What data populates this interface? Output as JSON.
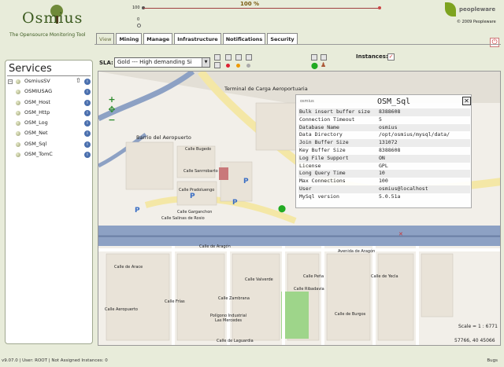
{
  "header": {
    "logo_text": "Osmius",
    "tagline": "The Opensource Monitoring Tool",
    "progress_percent_label": "100 %",
    "progress_start": "100",
    "progress_zero": "0",
    "progress_fraction": 1.0,
    "partner_logo": "peopleware",
    "copyright": "© 2009 Peopleware"
  },
  "tabs": [
    {
      "label": "View",
      "active": true
    },
    {
      "label": "Mining"
    },
    {
      "label": "Manage"
    },
    {
      "label": "Infrastructure"
    },
    {
      "label": "Notifications"
    },
    {
      "label": "Security"
    }
  ],
  "services": {
    "title": "Services",
    "items": [
      {
        "label": "OsmiusSV",
        "root": true
      },
      {
        "label": "OSMIUSAG"
      },
      {
        "label": "OSM_Host"
      },
      {
        "label": "OSM_Http"
      },
      {
        "label": "OSM_Log"
      },
      {
        "label": "OSM_Net"
      },
      {
        "label": "OSM_Sql"
      },
      {
        "label": "OSM_TomC"
      }
    ]
  },
  "toolbar": {
    "sla_label": "SLA:",
    "sla_value": "Gold --- High demanding Si",
    "instances_label": "Instances:",
    "instances_checked": true
  },
  "map": {
    "labels": [
      "Terminal de Carga Aeroportuaria",
      "Barrio del Aeropuerto",
      "Calle Bugedo",
      "Calle Sanrrobarto",
      "Calle Pradoluengo",
      "Calle Garganchon",
      "Calle Salinas de Rosio",
      "Calle de Aragón",
      "Avenida de Aragón",
      "Calle Zambrana",
      "Polígono Industrial Las Mercedes",
      "Calle de Laguardia",
      "Calle Ribadavia",
      "Calle de Arace",
      "Calle Aeropuerto",
      "Calle Frías",
      "Calle Valverde",
      "Calle Peña",
      "Calle de Yecla",
      "Calle de Burgos"
    ],
    "scale": "Scale = 1 : 6771",
    "coordinates": "57766, 40 45066"
  },
  "popup": {
    "subtitle": "osmius",
    "title": "OSM_Sql",
    "rows": [
      {
        "k": "Bulk insert buffer size",
        "v": "8388608"
      },
      {
        "k": "Connection Timeout",
        "v": "5"
      },
      {
        "k": "Database Name",
        "v": "osmius"
      },
      {
        "k": "Data Directory",
        "v": "/opt/osmius/mysql/data/"
      },
      {
        "k": "Join Buffer Size",
        "v": "131072"
      },
      {
        "k": "Key Buffer Size",
        "v": "8388608"
      },
      {
        "k": "Log File Support",
        "v": "ON"
      },
      {
        "k": "License",
        "v": "GPL"
      },
      {
        "k": "Long Query Time",
        "v": "10"
      },
      {
        "k": "Max Connections",
        "v": "100"
      },
      {
        "k": "User",
        "v": "osmius@localhost"
      },
      {
        "k": "MySql version",
        "v": "5.0.51a"
      }
    ]
  },
  "status": {
    "text": "v9.07.0 | User: ROOT | Not Assigned Instances: 0",
    "right": "Bugs"
  }
}
